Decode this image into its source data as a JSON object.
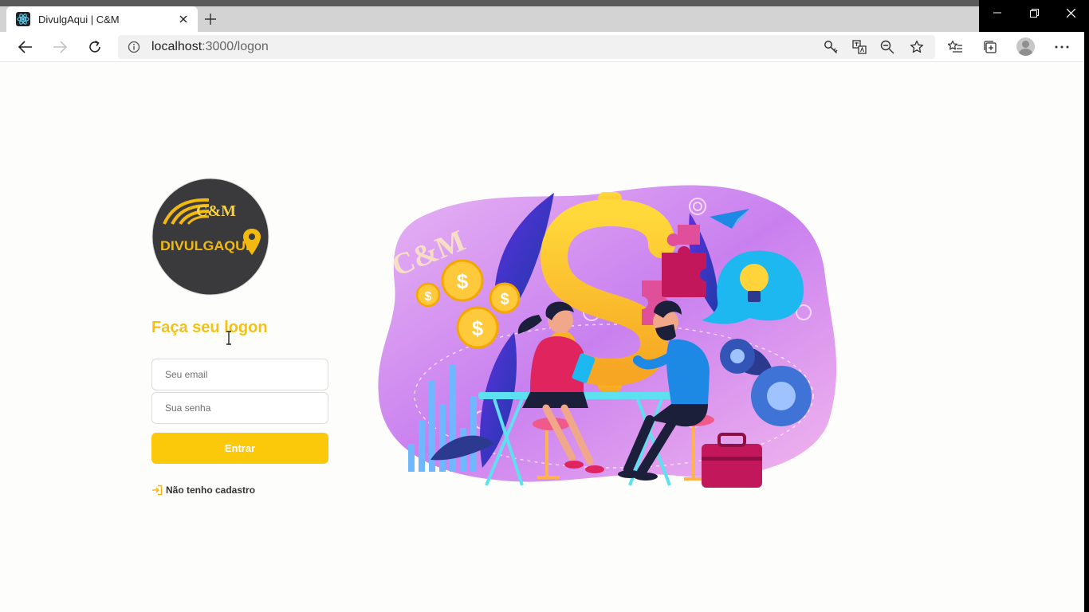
{
  "browser": {
    "tab_title": "DivulgAqui | C&M",
    "url_host": "localhost",
    "url_path": ":3000/logon",
    "icons": [
      "back-icon",
      "forward-icon",
      "refresh-icon",
      "info-icon",
      "key-icon",
      "translate-icon",
      "zoom-out-icon",
      "favorite-star-icon",
      "favorites-list-icon",
      "collections-icon",
      "profile-icon",
      "more-icon"
    ]
  },
  "logo": {
    "brand_top": "C&M",
    "brand_main": "DIVULGAQUI"
  },
  "logon": {
    "heading": "Faça seu logon",
    "email_placeholder": "Seu email",
    "password_placeholder": "Sua senha",
    "submit_label": "Entrar",
    "register_link": "Não tenho cadastro"
  },
  "hero": {
    "watermark": "C&M"
  },
  "colors": {
    "accent": "#fcc80a",
    "heading": "#f5c211",
    "logo_bg": "#3a3a3c"
  }
}
